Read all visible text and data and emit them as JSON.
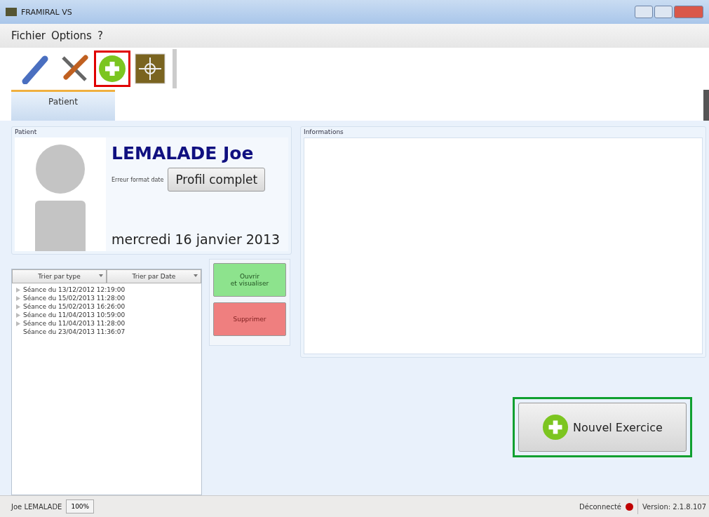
{
  "window": {
    "title": "FRAMIRAL VS"
  },
  "menu": [
    "Fichier",
    "Options",
    "?"
  ],
  "toolbar": [
    {
      "kind": "probe",
      "highlighted": false
    },
    {
      "kind": "tools",
      "highlighted": false
    },
    {
      "kind": "add",
      "highlighted": true
    },
    {
      "kind": "target",
      "highlighted": false
    }
  ],
  "tabs": [
    {
      "label": "Patient",
      "selected": true
    }
  ],
  "patient": {
    "group_title": "Patient",
    "name": "LEMALADE Joe",
    "date_error": "Erreur format date",
    "profile_button": "Profil complet",
    "date": "mercredi 16 janvier 2013"
  },
  "sessions": {
    "sort_headers": [
      "Trier par type",
      "Trier par Date"
    ],
    "items": [
      {
        "label": "Séance du 13/12/2012 12:19:00",
        "expandable": true
      },
      {
        "label": "Séance du 15/02/2013 11:28:00",
        "expandable": true
      },
      {
        "label": "Séance du 15/02/2013 16:26:00",
        "expandable": true
      },
      {
        "label": "Séance du 11/04/2013 10:59:00",
        "expandable": true
      },
      {
        "label": "Séance du 11/04/2013 11:28:00",
        "expandable": true
      },
      {
        "label": "Séance du 23/04/2013 11:36:07",
        "expandable": false
      }
    ]
  },
  "actions": [
    {
      "kind": "open",
      "label": "Ouvrir\net visualiser"
    },
    {
      "kind": "delete",
      "label": "Supprimer"
    }
  ],
  "informations": {
    "group_title": "Informations"
  },
  "new_exercise": {
    "label": "Nouvel Exercice",
    "highlighted": true
  },
  "status_bar": {
    "user": "Joe LEMALADE",
    "zoom": "100%",
    "connection": "Déconnecté",
    "connected": false,
    "version": "Version: 2.1.8.107"
  }
}
